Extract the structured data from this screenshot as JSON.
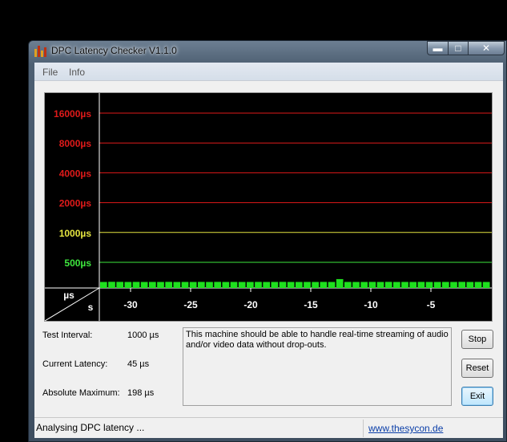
{
  "window": {
    "title": "DPC Latency Checker V1.1.0"
  },
  "menu": [
    "File",
    "Info"
  ],
  "chart_data": {
    "type": "bar",
    "y_levels": [
      {
        "label": "16000µs",
        "value": 16000,
        "color": "#e01a1a"
      },
      {
        "label": "8000µs",
        "value": 8000,
        "color": "#e01a1a"
      },
      {
        "label": "4000µs",
        "value": 4000,
        "color": "#e01a1a"
      },
      {
        "label": "2000µs",
        "value": 2000,
        "color": "#e01a1a"
      },
      {
        "label": "1000µs",
        "value": 1000,
        "color": "#e6e640"
      },
      {
        "label": "500µs",
        "value": 500,
        "color": "#3ee63e"
      }
    ],
    "x_ticks": [
      "-30",
      "-25",
      "-20",
      "-15",
      "-10",
      "-5"
    ],
    "y_unit": "µs",
    "x_unit": "s",
    "bar_color": "#1ee01e",
    "values": [
      45,
      50,
      48,
      45,
      47,
      45,
      46,
      45,
      48,
      45,
      46,
      45,
      47,
      45,
      48,
      45,
      46,
      45,
      45,
      47,
      45,
      46,
      48,
      45,
      45,
      46,
      45,
      47,
      45,
      198,
      46,
      45,
      45,
      47,
      45,
      48,
      45,
      46,
      45,
      47,
      45,
      45,
      46,
      45,
      48,
      45,
      46,
      45
    ]
  },
  "stats": {
    "test_interval_label": "Test Interval:",
    "test_interval_value": "1000 µs",
    "current_latency_label": "Current Latency:",
    "current_latency_value": "45 µs",
    "absolute_max_label": "Absolute Maximum:",
    "absolute_max_value": "198 µs"
  },
  "message": "This machine should be able to handle real-time streaming of audio and/or video data without drop-outs.",
  "buttons": {
    "stop": "Stop",
    "reset": "Reset",
    "exit": "Exit"
  },
  "status": {
    "text": "Analysing DPC latency ...",
    "link": "www.thesycon.de"
  },
  "colors": {
    "chart_bg": "#000000",
    "axis": "#ffffff"
  }
}
